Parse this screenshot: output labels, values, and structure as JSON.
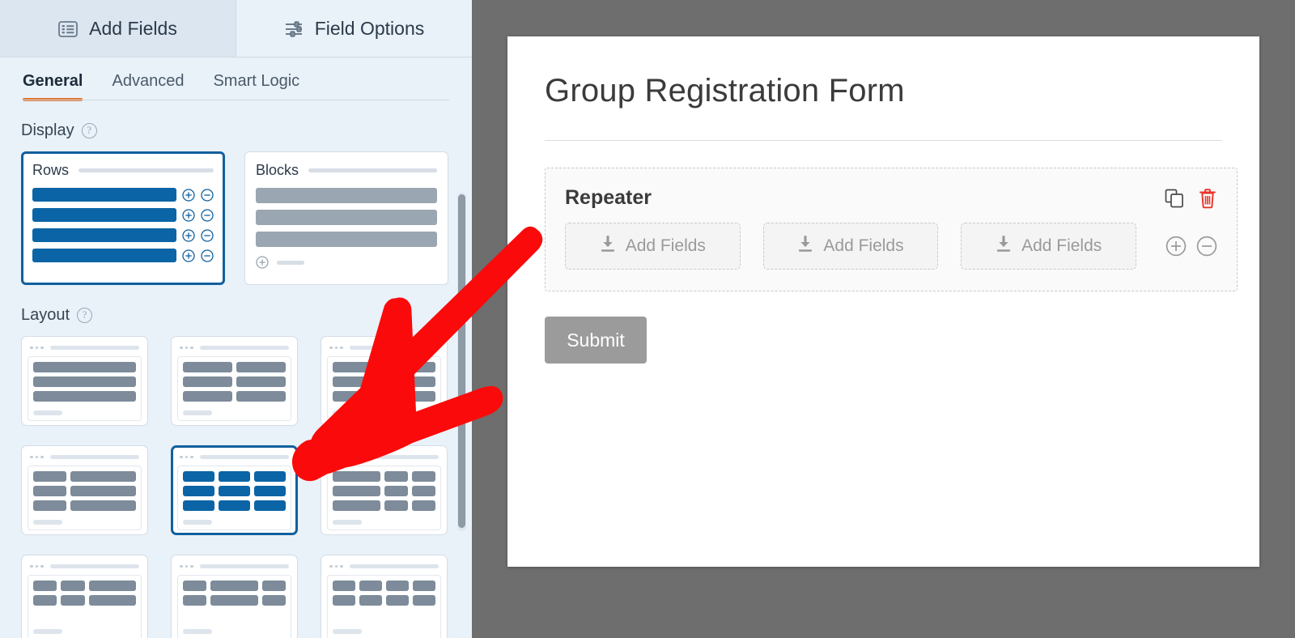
{
  "sidebar": {
    "tabs": [
      {
        "label": "Add Fields",
        "icon": "list-icon",
        "active": false
      },
      {
        "label": "Field Options",
        "icon": "sliders-icon",
        "active": true
      }
    ],
    "subtabs": [
      {
        "label": "General",
        "active": true
      },
      {
        "label": "Advanced",
        "active": false
      },
      {
        "label": "Smart Logic",
        "active": false
      }
    ],
    "display": {
      "label": "Display",
      "help_icon": "question-mark-icon",
      "options": [
        {
          "title": "Rows",
          "selected": true,
          "rows": 4,
          "control_icons": [
            "plus-circle-icon",
            "minus-circle-icon"
          ]
        },
        {
          "title": "Blocks",
          "selected": false,
          "rows": 3,
          "control_icons": [
            "plus-circle-icon"
          ]
        }
      ]
    },
    "layout": {
      "label": "Layout",
      "help_icon": "question-mark-icon",
      "options": [
        {
          "id": "one-column",
          "selected": false,
          "grid": [
            [
              12
            ],
            [
              12
            ],
            [
              12
            ]
          ]
        },
        {
          "id": "two-columns",
          "selected": false,
          "grid": [
            [
              6,
              6
            ],
            [
              6,
              6
            ],
            [
              6,
              6
            ]
          ]
        },
        {
          "id": "two-thirds-one-third",
          "selected": false,
          "grid": [
            [
              8,
              4
            ],
            [
              8,
              4
            ],
            [
              8,
              4
            ]
          ]
        },
        {
          "id": "one-third-two-thirds",
          "selected": false,
          "grid": [
            [
              4,
              8
            ],
            [
              4,
              8
            ],
            [
              4,
              8
            ]
          ]
        },
        {
          "id": "three-columns",
          "selected": true,
          "grid": [
            [
              4,
              4,
              4
            ],
            [
              4,
              4,
              4
            ],
            [
              4,
              4,
              4
            ]
          ]
        },
        {
          "id": "half-quarter-quarter",
          "selected": false,
          "grid": [
            [
              6,
              3,
              3
            ],
            [
              6,
              3,
              3
            ],
            [
              6,
              3,
              3
            ]
          ]
        },
        {
          "id": "quarter-quarter-half",
          "selected": false,
          "grid": [
            [
              3,
              3,
              6
            ],
            [
              3,
              3,
              6
            ]
          ]
        },
        {
          "id": "quarter-half-quarter",
          "selected": false,
          "grid": [
            [
              3,
              6,
              3
            ],
            [
              3,
              6,
              3
            ]
          ]
        },
        {
          "id": "four-columns",
          "selected": false,
          "grid": [
            [
              3,
              3,
              3,
              3
            ],
            [
              3,
              3,
              3,
              3
            ]
          ]
        }
      ]
    },
    "collapse_icon": "chevron-left-icon",
    "scrollbar": "vertical-scrollbar"
  },
  "preview": {
    "form_title": "Group Registration Form",
    "repeater": {
      "title": "Repeater",
      "duplicate_icon": "copy-icon",
      "delete_icon": "trash-icon",
      "add_field_label": "Add Fields",
      "add_field_icon": "download-icon",
      "columns": 3,
      "add_row_icon": "plus-circle-icon",
      "remove_row_icon": "minus-circle-icon"
    },
    "submit_label": "Submit"
  },
  "colors": {
    "accent_orange": "#e27730",
    "selection_blue": "#11609e",
    "bar_blue": "#0b64a5",
    "bar_gray": "#7d8b9a",
    "sidebar_bg": "#e9f1f9",
    "preview_bg": "#6e6e6e",
    "delete_red": "#e8342a",
    "submit_gray": "#9b9b9b",
    "annotation_red": "#fa0a0a"
  }
}
